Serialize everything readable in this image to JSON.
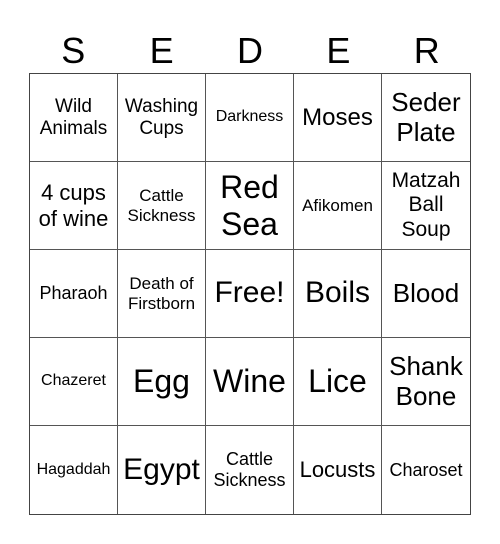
{
  "title_letters": [
    "S",
    "E",
    "D",
    "E",
    "R"
  ],
  "cells": [
    [
      "Wild Animals",
      "Washing Cups",
      "Darkness",
      "Moses",
      "Seder Plate"
    ],
    [
      "4 cups of wine",
      "Cattle Sickness",
      "Red Sea",
      "Afikomen",
      "Matzah Ball Soup"
    ],
    [
      "Pharaoh",
      "Death of Firstborn",
      "Free!",
      "Boils",
      "Blood"
    ],
    [
      "Chazeret",
      "Egg",
      "Wine",
      "Lice",
      "Shank Bone"
    ],
    [
      "Hagaddah",
      "Egypt",
      "Cattle Sickness",
      "Locusts",
      "Charoset"
    ]
  ],
  "free_space": {
    "row": 2,
    "col": 2,
    "label": "Free!"
  }
}
